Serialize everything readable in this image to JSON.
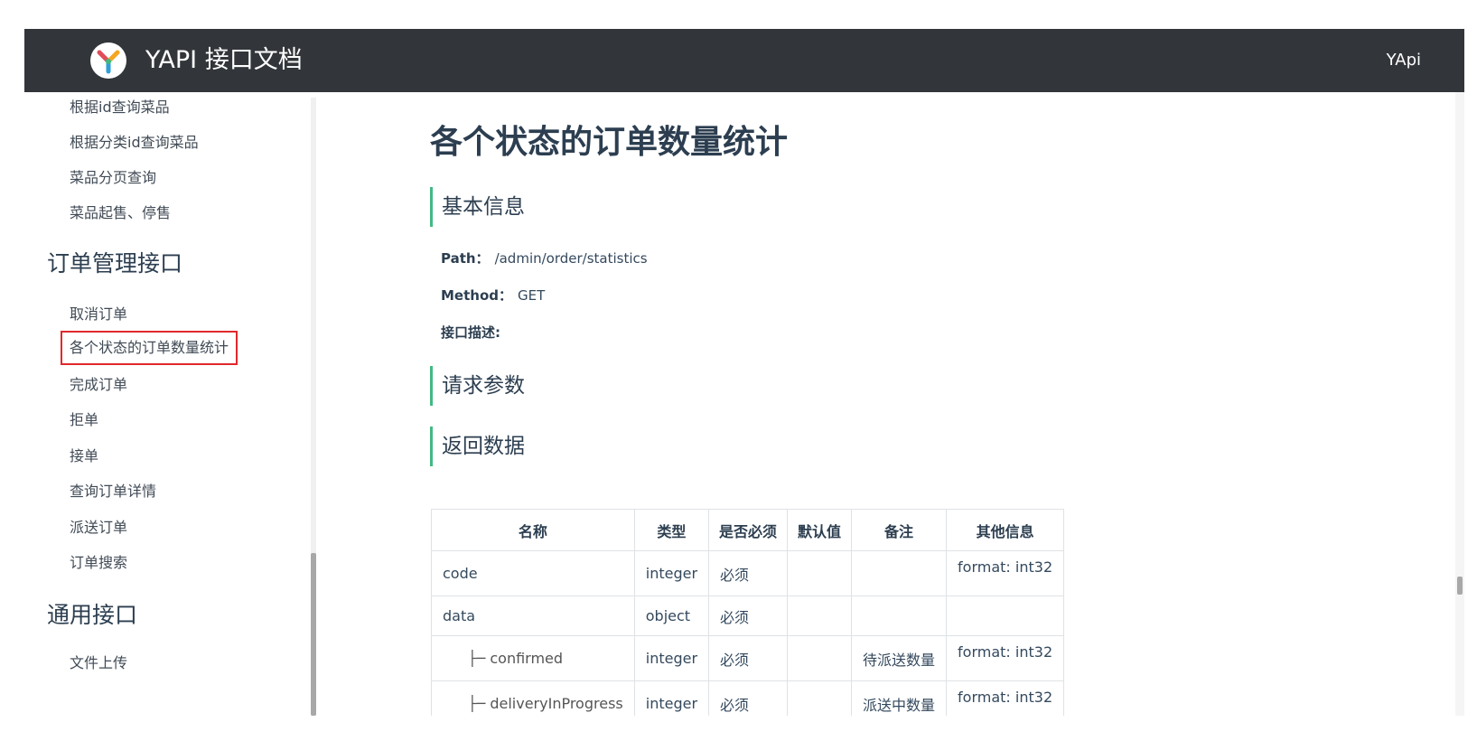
{
  "header": {
    "title": "YAPI 接口文档",
    "right_link": "YApi"
  },
  "sidebar": {
    "items_top": [
      {
        "label": "根据id查询菜品"
      },
      {
        "label": "根据分类id查询菜品"
      },
      {
        "label": "菜品分页查询"
      },
      {
        "label": "菜品起售、停售"
      }
    ],
    "group_order": "订单管理接口",
    "order_items": [
      {
        "label": "取消订单"
      },
      {
        "label": "各个状态的订单数量统计"
      },
      {
        "label": "完成订单"
      },
      {
        "label": "拒单"
      },
      {
        "label": "接单"
      },
      {
        "label": "查询订单详情"
      },
      {
        "label": "派送订单"
      },
      {
        "label": "订单搜索"
      }
    ],
    "group_common": "通用接口",
    "common_items": [
      {
        "label": "文件上传"
      }
    ]
  },
  "main": {
    "title": "各个状态的订单数量统计",
    "section_basic": "基本信息",
    "path_label": "Path：",
    "path_value": "/admin/order/statistics",
    "method_label": "Method：",
    "method_value": "GET",
    "desc_label": "接口描述:",
    "section_request": "请求参数",
    "section_response": "返回数据",
    "table": {
      "headers": [
        "名称",
        "类型",
        "是否必须",
        "默认值",
        "备注",
        "其他信息"
      ],
      "rows": [
        {
          "name": "code",
          "type": "integer",
          "required": "必须",
          "default": "",
          "note": "",
          "other": "format: int32"
        },
        {
          "name": "data",
          "type": "object",
          "required": "必须",
          "default": "",
          "note": "",
          "other": ""
        },
        {
          "name": "├─ confirmed",
          "type": "integer",
          "required": "必须",
          "default": "",
          "note": "待派送数量",
          "other": "format: int32"
        },
        {
          "name": "├─ deliveryInProgress",
          "type": "integer",
          "required": "必须",
          "default": "",
          "note": "派送中数量",
          "other": "format: int32"
        }
      ]
    }
  },
  "colors": {
    "header_bg": "#32363a",
    "section_accent": "#42b983",
    "active_outline": "#e0282c"
  }
}
